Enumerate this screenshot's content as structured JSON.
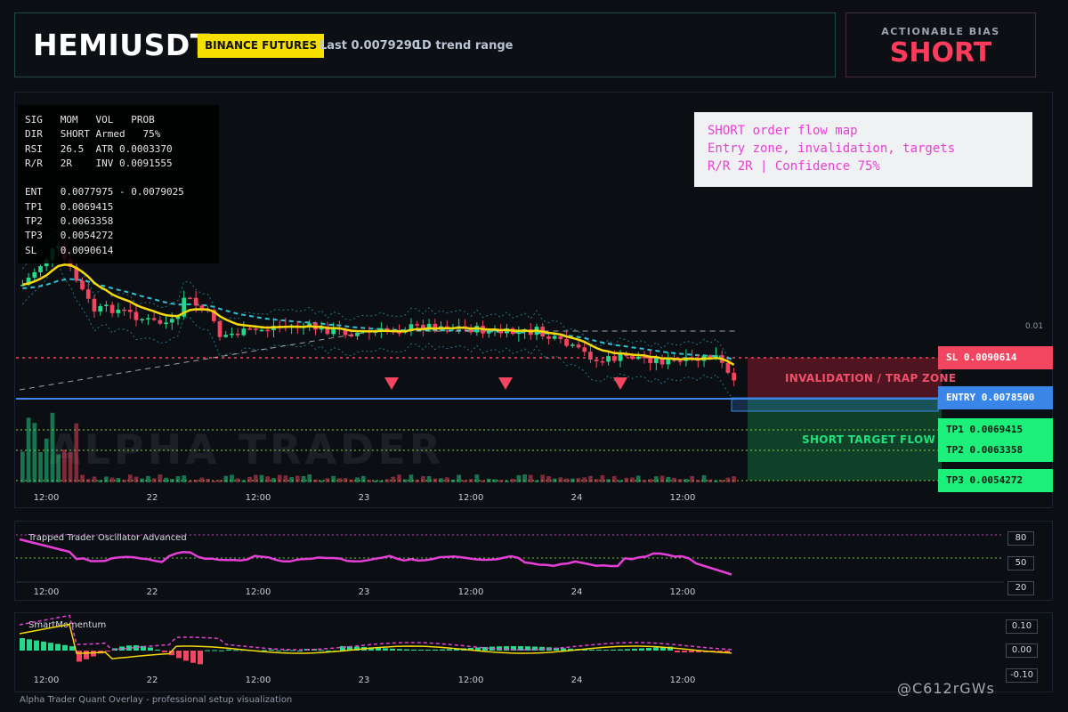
{
  "header": {
    "symbol": "HEMIUSDT",
    "exchange": "BINANCE FUTURES",
    "last_price": "Last 0.0079290",
    "trend_range": "1D trend range"
  },
  "bias": {
    "label": "ACTIONABLE BIAS",
    "value": "SHORT"
  },
  "info_table": {
    "rows": [
      "SIG   MOM   VOL   PROB",
      "DIR   SHORT Armed   75%",
      "RSI   26.5  ATR 0.0003370",
      "R/R   2R    INV 0.0091555",
      "",
      "ENT   0.0077975 - 0.0079025",
      "TP1   0.0069415",
      "TP2   0.0063358",
      "TP3   0.0054272",
      "SL    0.0090614"
    ]
  },
  "note": {
    "line1": "SHORT order flow map",
    "line2": "Entry zone, invalidation, targets",
    "line3": "R/R 2R | Confidence 75%"
  },
  "levels": {
    "sl": "SL 0.0090614",
    "entry": "ENTRY 0.0078500",
    "tp1": "TP1 0.0069415",
    "tp2": "TP2 0.0063358",
    "tp3": "TP3 0.0054272"
  },
  "zones": {
    "invalidation": "INVALIDATION / TRAP ZONE",
    "target": "SHORT TARGET FLOW"
  },
  "price_axis": {
    "tick": "0.01"
  },
  "time_axis": [
    "12:00",
    "22",
    "12:00",
    "23",
    "12:00",
    "24",
    "12:00"
  ],
  "watermark": "ALPHA TRADER",
  "oscillator": {
    "title": "Trapped Trader Oscillator Advanced",
    "scale": [
      "80",
      "50",
      "20"
    ]
  },
  "momentum": {
    "title": "SmartMomentum",
    "scale": [
      "0.10",
      "0.00",
      "-0.10"
    ]
  },
  "footer": "Alpha Trader Quant Overlay - professional setup visualization",
  "signature": "@C612rGWs",
  "colors": {
    "bull": "#26d98a",
    "bear": "#f2455f",
    "ema": "#f5d90a",
    "band": "#2fc1d6",
    "entry_line": "#3a86e8",
    "osc_line": "#e63fd8"
  }
}
